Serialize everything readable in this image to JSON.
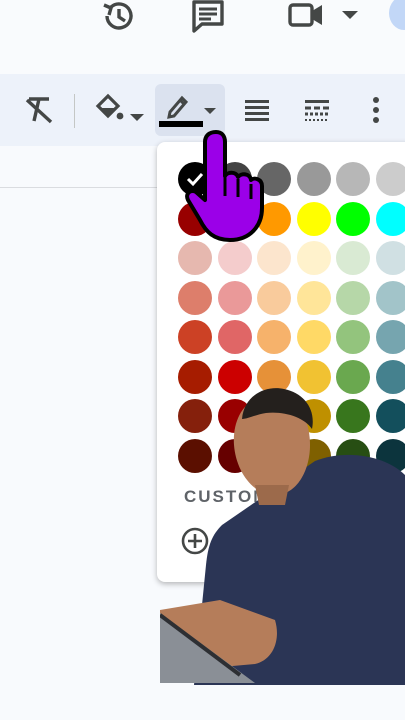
{
  "icons": {
    "history": "history-icon",
    "comment": "comment-icon",
    "meet": "video-icon",
    "clear_format": "clear-formatting-icon",
    "fill": "paint-bucket-icon",
    "pen": "pen-icon",
    "line_weight": "line-weight-icon",
    "line_dash": "line-dash-icon",
    "more": "more-vert-icon"
  },
  "pen_color": "#000000",
  "palette": {
    "rows": [
      [
        "#000000",
        "#434343",
        "#666666",
        "#999999",
        "#b7b7b7",
        "#cccccc"
      ],
      [
        "#980000",
        "#ff0000",
        "#ff9900",
        "#ffff00",
        "#00ff00",
        "#00ffff"
      ],
      [
        "#e6b8af",
        "#f4cccc",
        "#fce5cd",
        "#fff2cc",
        "#d9ead3",
        "#d0e0e3"
      ],
      [
        "#dd7e6b",
        "#ea9999",
        "#f9cb9c",
        "#ffe599",
        "#b6d7a8",
        "#a2c4c9"
      ],
      [
        "#cc4125",
        "#e06666",
        "#f6b26b",
        "#ffd966",
        "#93c47d",
        "#76a5af"
      ],
      [
        "#a61c00",
        "#cc0000",
        "#e69138",
        "#f1c232",
        "#6aa84f",
        "#45818e"
      ],
      [
        "#85200c",
        "#990000",
        "#b45f06",
        "#bf9000",
        "#38761d",
        "#134f5c"
      ],
      [
        "#5b0f00",
        "#660000",
        "#783f04",
        "#7f6000",
        "#274e13",
        "#0c343d"
      ]
    ],
    "selected": "#000000",
    "custom_label": "CUSTOM"
  },
  "overlay_colors": {
    "pointer_hand": "#9b00e8"
  }
}
